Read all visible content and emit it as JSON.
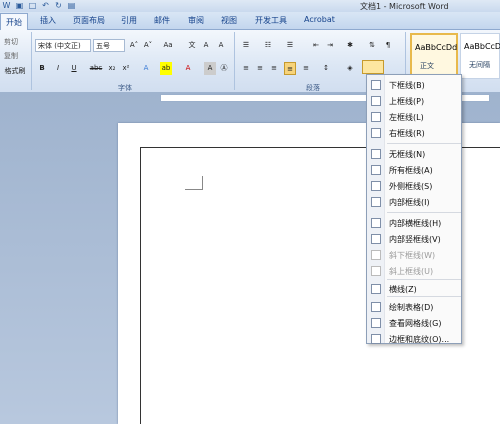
{
  "window": {
    "title": "文档1 - Microsoft Word"
  },
  "tabs": [
    {
      "label": "开始"
    },
    {
      "label": "插入"
    },
    {
      "label": "页面布局"
    },
    {
      "label": "引用"
    },
    {
      "label": "邮件"
    },
    {
      "label": "审阅"
    },
    {
      "label": "视图"
    },
    {
      "label": "开发工具"
    },
    {
      "label": "Acrobat"
    }
  ],
  "clipboard": {
    "cut": "剪切",
    "copy": "复制",
    "format_painter": "格式刷"
  },
  "font": {
    "name": "宋体 (中文正)",
    "size": "五号",
    "group_label": "字体",
    "bold": "B",
    "italic": "I",
    "underline": "U",
    "strike": "abc"
  },
  "paragraph": {
    "group_label": "段落"
  },
  "styles": [
    {
      "sample": "AaBbCcDd",
      "name": "正文"
    },
    {
      "sample": "AaBbCcDd",
      "name": "无间隔"
    }
  ],
  "menu": {
    "items": [
      {
        "label": "下框线(B)",
        "enabled": true,
        "icon": "border-bottom-icon"
      },
      {
        "label": "上框线(P)",
        "enabled": true,
        "icon": "border-top-icon"
      },
      {
        "label": "左框线(L)",
        "enabled": true,
        "icon": "border-left-icon"
      },
      {
        "label": "右框线(R)",
        "enabled": true,
        "icon": "border-right-icon"
      },
      {
        "label": "无框线(N)",
        "enabled": true,
        "icon": "border-none-icon"
      },
      {
        "label": "所有框线(A)",
        "enabled": true,
        "icon": "border-all-icon"
      },
      {
        "label": "外侧框线(S)",
        "enabled": true,
        "icon": "border-outside-icon"
      },
      {
        "label": "内部框线(I)",
        "enabled": true,
        "icon": "border-inside-icon"
      },
      {
        "label": "内部横框线(H)",
        "enabled": true,
        "icon": "border-inside-horizontal-icon"
      },
      {
        "label": "内部竖框线(V)",
        "enabled": true,
        "icon": "border-inside-vertical-icon"
      },
      {
        "label": "斜下框线(W)",
        "enabled": false,
        "icon": "border-diag-down-icon"
      },
      {
        "label": "斜上框线(U)",
        "enabled": false,
        "icon": "border-diag-up-icon"
      },
      {
        "label": "横线(Z)",
        "enabled": true,
        "icon": "horizontal-line-icon"
      },
      {
        "label": "绘制表格(D)",
        "enabled": true,
        "icon": "draw-table-icon"
      },
      {
        "label": "查看网格线(G)",
        "enabled": true,
        "icon": "view-gridlines-icon"
      },
      {
        "label": "边框和底纹(O)...",
        "enabled": true,
        "icon": "borders-shading-icon"
      }
    ]
  }
}
